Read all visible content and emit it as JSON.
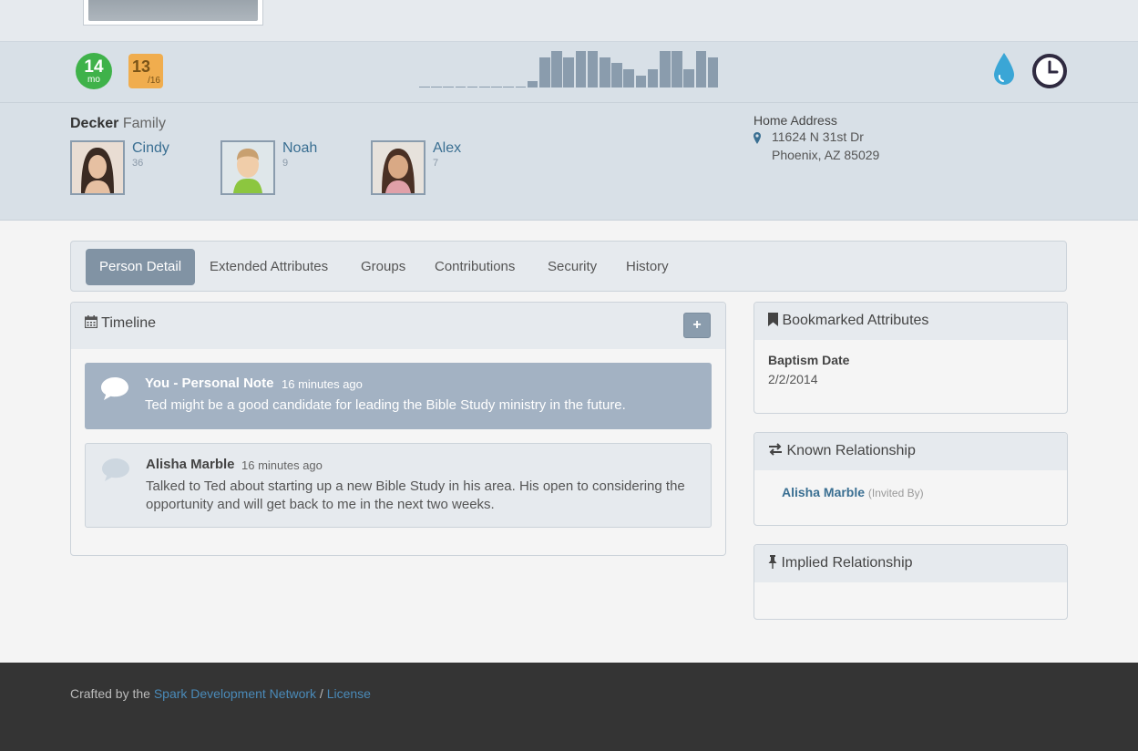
{
  "badges": {
    "months_value": "14",
    "months_unit": "mo",
    "attendance_value": "13",
    "attendance_total": "/16"
  },
  "activity_sparkline": {
    "values": [
      0,
      0,
      0,
      0,
      0,
      0,
      0,
      0,
      0,
      1,
      5,
      6,
      5,
      6,
      6,
      5,
      4,
      3,
      2,
      3,
      6,
      6,
      3,
      6,
      5
    ]
  },
  "family": {
    "last_name": "Decker",
    "suffix": "Family",
    "members": [
      {
        "name": "Cindy",
        "age": "36"
      },
      {
        "name": "Noah",
        "age": "9"
      },
      {
        "name": "Alex",
        "age": "7"
      }
    ]
  },
  "address": {
    "label": "Home Address",
    "line1": "11624 N 31st Dr",
    "line2": "Phoenix, AZ 85029"
  },
  "tabs": [
    "Person Detail",
    "Extended Attributes",
    "Groups",
    "Contributions",
    "Security",
    "History"
  ],
  "timeline": {
    "title": "Timeline",
    "add_label": "+",
    "entries": [
      {
        "author": "You - Personal Note",
        "time": "16 minutes ago",
        "text": "Ted might be a good candidate for leading the Bible Study ministry in the future."
      },
      {
        "author": "Alisha Marble",
        "time": "16 minutes ago",
        "text": "Talked to Ted about starting up a new Bible Study in his area. His open to considering the opportunity and will get back to me in the next two weeks."
      }
    ]
  },
  "bookmarked": {
    "title": "Bookmarked Attributes",
    "attr_name": "Baptism Date",
    "attr_value": "2/2/2014"
  },
  "known_relationship": {
    "title": "Known Relationship",
    "person": "Alisha Marble",
    "relation": "(Invited By)"
  },
  "implied_relationship": {
    "title": "Implied Relationship"
  },
  "footer": {
    "prefix": "Crafted by the",
    "link1": "Spark Development Network",
    "sep": "/",
    "link2": "License"
  },
  "colors": {
    "accent": "#3a6f92",
    "success": "#3fb24a",
    "warning": "#f0ad4e",
    "info": "#3aa6d6"
  }
}
